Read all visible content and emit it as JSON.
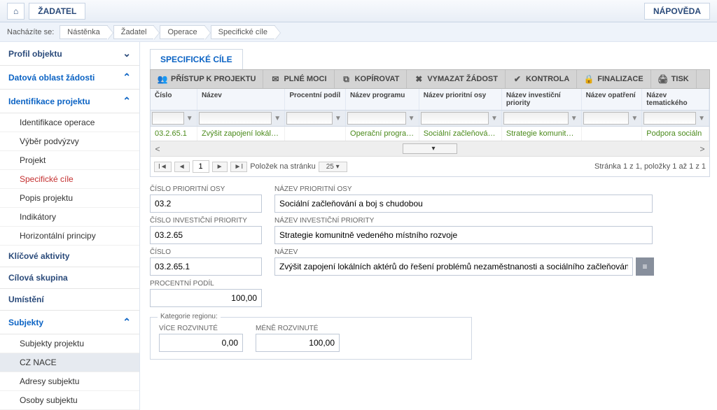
{
  "header": {
    "home_icon": "⌂",
    "zadatel": "ŽADATEL",
    "napoveda": "NÁPOVĚDA"
  },
  "breadcrumb": {
    "label": "Nacházíte se:",
    "items": [
      "Nástěnka",
      "Žadatel",
      "Operace",
      "Specifické cíle"
    ]
  },
  "sidebar": {
    "profil": "Profil objektu",
    "datova": "Datová oblast žádosti",
    "ident": "Identifikace projektu",
    "ident_items": [
      "Identifikace operace",
      "Výběr podvýzvy",
      "Projekt",
      "Specifické cíle",
      "Popis projektu",
      "Indikátory",
      "Horizontální principy"
    ],
    "klicove": "Klíčové aktivity",
    "cilova": "Cílová skupina",
    "umisteni": "Umístění",
    "subjekty": "Subjekty",
    "subjekty_items": [
      "Subjekty projektu",
      "CZ NACE",
      "Adresy subjektu",
      "Osoby subjektu"
    ]
  },
  "tab": "SPECIFICKÉ CÍLE",
  "toolbar": {
    "pristup": "PŘÍSTUP K PROJEKTU",
    "plne": "PLNÉ MOCI",
    "kopirovat": "KOPÍROVAT",
    "vymazat": "VYMAZAT ŽÁDOST",
    "kontrola": "KONTROLA",
    "finalizace": "FINALIZACE",
    "tisk": "TISK"
  },
  "grid": {
    "headers": [
      "Číslo",
      "Název",
      "Procentní podíl",
      "Název programu",
      "Název prioritní osy",
      "Název investiční priority",
      "Název opatření",
      "Název tematického"
    ],
    "row": [
      "03.2.65.1",
      "Zvýšit zapojení lokálních akt...",
      "",
      "Operační program Zam...",
      "Sociální začleňování a...",
      "Strategie komunitně v...",
      "",
      "Podpora sociáln"
    ]
  },
  "pager": {
    "page": "1",
    "label": "Položek na stránku",
    "size": "25",
    "info": "Stránka 1 z 1, položky 1 až 1 z 1"
  },
  "form": {
    "cpo_label": "ČÍSLO PRIORITNÍ OSY",
    "cpo": "03.2",
    "npo_label": "NÁZEV PRIORITNÍ OSY",
    "npo": "Sociální začleňování a boj s chudobou",
    "cip_label": "ČÍSLO INVESTIČNÍ PRIORITY",
    "cip": "03.2.65",
    "nip_label": "NÁZEV INVESTIČNÍ PRIORITY",
    "nip": "Strategie komunitně vedeného místního rozvoje",
    "cislo_label": "ČÍSLO",
    "cislo": "03.2.65.1",
    "nazev_label": "NÁZEV",
    "nazev": "Zvýšit zapojení lokálních aktérů do řešení problémů nezaměstnanosti a sociálního začleňování ve venkovských obl...",
    "pp_label": "PROCENTNÍ PODÍL",
    "pp": "100,00",
    "kr_legend": "Kategorie regionu:",
    "vice_label": "VÍCE ROZVINUTÉ",
    "vice": "0,00",
    "mene_label": "MÉNĚ ROZVINUTÉ",
    "mene": "100,00"
  }
}
